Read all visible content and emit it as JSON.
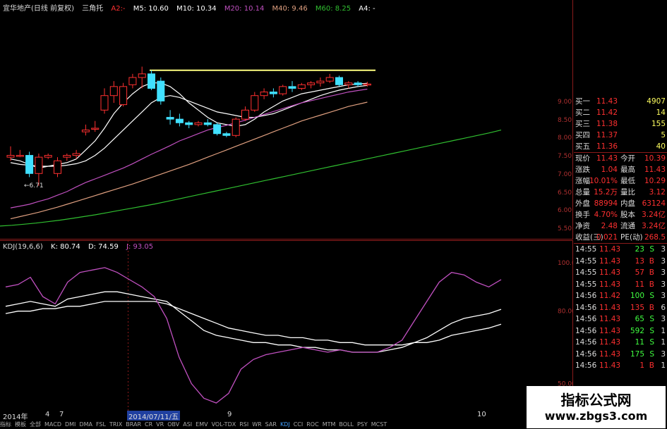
{
  "header": {
    "stock_name": "宜华地产(日线 前复权)",
    "indicator": "三角托",
    "a2": "A2:-",
    "m5": "M5: 10.60",
    "m10": "M10: 10.34",
    "m20": "M20: 10.14",
    "m40": "M40: 9.46",
    "m60": "M60: 8.25",
    "a4": "A4: -",
    "colors": {
      "a2": "#ff3030",
      "m5": "#ffffff",
      "m10": "#ffffff",
      "m20": "#c050c0",
      "m40": "#e0a080",
      "m60": "#30c030",
      "a4": "#ffffff"
    }
  },
  "price_axis": [
    "9.00",
    "8.50",
    "8.00",
    "7.50",
    "7.00",
    "6.50",
    "6.00",
    "5.50"
  ],
  "low_marker": "←6.71",
  "kdj": {
    "title": "KDJ(19,6,6)",
    "k": "K: 80.74",
    "d": "D: 74.59",
    "j": "J: 93.05",
    "k_color": "#ffffff",
    "d_color": "#ffffff",
    "j_color": "#c050c0",
    "axis": [
      "100.00",
      "80.00",
      "50.00"
    ]
  },
  "chart_data": [
    {
      "type": "candlestick",
      "title": "宜华地产(日线 前复权)",
      "y_ticks": [
        9.0,
        8.5,
        8.0,
        7.5,
        7.0,
        6.5,
        6.0,
        5.5
      ],
      "candles": [
        {
          "o": 7.5,
          "h": 7.8,
          "l": 7.4,
          "c": 7.55
        },
        {
          "o": 7.55,
          "h": 7.7,
          "l": 7.5,
          "c": 7.55
        },
        {
          "o": 7.55,
          "h": 7.65,
          "l": 6.95,
          "c": 7.05
        },
        {
          "o": 7.05,
          "h": 7.6,
          "l": 6.71,
          "c": 7.5
        },
        {
          "o": 7.5,
          "h": 7.6,
          "l": 7.45,
          "c": 7.55
        },
        {
          "o": 7.05,
          "h": 7.5,
          "l": 6.95,
          "c": 7.4
        },
        {
          "o": 7.5,
          "h": 7.6,
          "l": 7.4,
          "c": 7.55
        },
        {
          "o": 7.55,
          "h": 7.7,
          "l": 7.45,
          "c": 7.6
        },
        {
          "o": 8.2,
          "h": 8.4,
          "l": 8.1,
          "c": 8.25
        },
        {
          "o": 8.3,
          "h": 8.5,
          "l": 8.2,
          "c": 8.3
        },
        {
          "o": 8.8,
          "h": 9.4,
          "l": 8.7,
          "c": 9.2
        },
        {
          "o": 9.2,
          "h": 9.6,
          "l": 9.0,
          "c": 9.45
        },
        {
          "o": 8.95,
          "h": 9.55,
          "l": 8.9,
          "c": 9.45
        },
        {
          "o": 9.5,
          "h": 9.8,
          "l": 9.4,
          "c": 9.7
        },
        {
          "o": 9.7,
          "h": 10.0,
          "l": 9.4,
          "c": 9.8
        },
        {
          "o": 9.8,
          "h": 9.9,
          "l": 9.35,
          "c": 9.4
        },
        {
          "o": 9.6,
          "h": 9.7,
          "l": 8.95,
          "c": 9.05
        },
        {
          "o": 8.6,
          "h": 8.8,
          "l": 8.4,
          "c": 8.55
        },
        {
          "o": 8.55,
          "h": 8.7,
          "l": 8.35,
          "c": 8.45
        },
        {
          "o": 8.45,
          "h": 8.5,
          "l": 8.3,
          "c": 8.4
        },
        {
          "o": 8.4,
          "h": 8.5,
          "l": 8.35,
          "c": 8.45
        },
        {
          "o": 8.45,
          "h": 8.55,
          "l": 8.35,
          "c": 8.4
        },
        {
          "o": 8.4,
          "h": 8.45,
          "l": 8.1,
          "c": 8.15
        },
        {
          "o": 8.15,
          "h": 8.2,
          "l": 8.05,
          "c": 8.1
        },
        {
          "o": 8.1,
          "h": 8.6,
          "l": 8.05,
          "c": 8.55
        },
        {
          "o": 8.55,
          "h": 8.9,
          "l": 8.5,
          "c": 8.8
        },
        {
          "o": 8.8,
          "h": 9.3,
          "l": 8.75,
          "c": 9.2
        },
        {
          "o": 9.2,
          "h": 9.4,
          "l": 9.1,
          "c": 9.3
        },
        {
          "o": 9.3,
          "h": 9.4,
          "l": 9.15,
          "c": 9.25
        },
        {
          "o": 9.25,
          "h": 9.5,
          "l": 9.2,
          "c": 9.45
        },
        {
          "o": 9.45,
          "h": 9.6,
          "l": 9.3,
          "c": 9.4
        },
        {
          "o": 9.4,
          "h": 9.55,
          "l": 9.35,
          "c": 9.5
        },
        {
          "o": 9.5,
          "h": 9.6,
          "l": 9.4,
          "c": 9.55
        },
        {
          "o": 9.55,
          "h": 9.7,
          "l": 9.45,
          "c": 9.6
        },
        {
          "o": 9.6,
          "h": 9.8,
          "l": 9.55,
          "c": 9.7
        },
        {
          "o": 9.7,
          "h": 9.75,
          "l": 9.45,
          "c": 9.5
        },
        {
          "o": 9.5,
          "h": 9.6,
          "l": 9.4,
          "c": 9.55
        },
        {
          "o": 9.55,
          "h": 9.6,
          "l": 9.45,
          "c": 9.5
        },
        {
          "o": 9.5,
          "h": 9.58,
          "l": 9.45,
          "c": 9.52
        }
      ],
      "resistance_line": 9.9,
      "ma_series": [
        {
          "name": "M5",
          "color": "#ffffff",
          "values": [
            7.45,
            7.4,
            7.3,
            7.2,
            7.25,
            7.3,
            7.35,
            7.45,
            7.7,
            7.95,
            8.3,
            8.7,
            9.0,
            9.25,
            9.45,
            9.55,
            9.55,
            9.45,
            9.25,
            9.0,
            8.8,
            8.6,
            8.45,
            8.4,
            8.35,
            8.4,
            8.55,
            8.75,
            8.9,
            9.05,
            9.15,
            9.25,
            9.3,
            9.35,
            9.4,
            9.45,
            9.5,
            9.52,
            9.54
          ]
        },
        {
          "name": "M10",
          "color": "#ffffff",
          "values": [
            7.35,
            7.3,
            7.28,
            7.25,
            7.25,
            7.25,
            7.28,
            7.32,
            7.4,
            7.55,
            7.75,
            8.0,
            8.25,
            8.5,
            8.75,
            9.0,
            9.15,
            9.2,
            9.15,
            9.05,
            8.95,
            8.85,
            8.75,
            8.7,
            8.65,
            8.6,
            8.6,
            8.65,
            8.7,
            8.8,
            8.9,
            9.0,
            9.1,
            9.2,
            9.28,
            9.35,
            9.4,
            9.45,
            9.48
          ]
        },
        {
          "name": "M20",
          "color": "#c050c0",
          "values": [
            6.1,
            6.15,
            6.2,
            6.28,
            6.35,
            6.45,
            6.55,
            6.68,
            6.8,
            6.9,
            7.0,
            7.1,
            7.2,
            7.32,
            7.45,
            7.58,
            7.7,
            7.82,
            7.95,
            8.05,
            8.15,
            8.25,
            8.32,
            8.38,
            8.45,
            8.52,
            8.6,
            8.68,
            8.76,
            8.84,
            8.92,
            9.0,
            9.06,
            9.12,
            9.18,
            9.24,
            9.3,
            9.34,
            9.38
          ]
        },
        {
          "name": "M40",
          "color": "#e0a080",
          "values": [
            5.8,
            5.86,
            5.92,
            5.98,
            6.05,
            6.12,
            6.2,
            6.28,
            6.36,
            6.44,
            6.52,
            6.6,
            6.68,
            6.76,
            6.85,
            6.94,
            7.03,
            7.12,
            7.21,
            7.3,
            7.4,
            7.5,
            7.6,
            7.7,
            7.8,
            7.9,
            8.0,
            8.1,
            8.2,
            8.3,
            8.4,
            8.5,
            8.58,
            8.66,
            8.74,
            8.82,
            8.9,
            8.96,
            9.02
          ]
        },
        {
          "name": "M60",
          "color": "#30c030",
          "values": [
            5.6,
            5.62,
            5.65,
            5.68,
            5.72,
            5.76,
            5.81,
            5.86,
            5.91,
            5.97,
            6.03,
            6.09,
            6.15,
            6.21,
            6.28,
            6.35,
            6.42,
            6.49,
            6.56,
            6.63,
            6.7,
            6.77,
            6.84,
            6.91,
            6.98,
            7.05,
            7.12,
            7.19,
            7.26,
            7.33,
            7.4,
            7.47,
            7.54,
            7.61,
            7.68,
            7.75,
            7.82,
            7.89,
            7.96,
            8.03,
            8.1,
            8.17,
            8.25
          ]
        }
      ]
    },
    {
      "type": "line",
      "title": "KDJ(19,6,6)",
      "y_ticks": [
        100,
        80,
        50
      ],
      "series": [
        {
          "name": "K",
          "color": "#ffffff",
          "values": [
            82,
            83,
            84,
            83,
            82,
            85,
            86,
            87,
            88,
            88,
            87,
            86,
            85,
            84,
            80,
            76,
            72,
            70,
            69,
            68,
            67,
            67,
            66,
            66,
            65,
            65,
            64,
            64,
            63,
            63,
            63,
            64,
            65,
            67,
            69,
            72,
            75,
            77,
            78,
            79,
            80.74
          ]
        },
        {
          "name": "D",
          "color": "#ffffff",
          "values": [
            79,
            80,
            80,
            81,
            81,
            82,
            82,
            83,
            84,
            84,
            84,
            84,
            84,
            83,
            81,
            79,
            77,
            75,
            73,
            72,
            71,
            70,
            70,
            69,
            69,
            68,
            68,
            67,
            67,
            66,
            66,
            66,
            66,
            67,
            67,
            68,
            70,
            71,
            72,
            73,
            74.59
          ]
        },
        {
          "name": "J",
          "color": "#c050c0",
          "values": [
            90,
            91,
            94,
            86,
            83,
            92,
            96,
            97,
            98,
            96,
            93,
            90,
            86,
            77,
            61,
            50,
            44,
            42,
            46,
            56,
            60,
            62,
            63,
            64,
            65,
            64,
            63,
            64,
            63,
            63,
            63,
            65,
            68,
            76,
            84,
            92,
            96,
            95,
            92,
            90,
            93.05
          ]
        }
      ]
    }
  ],
  "quote_panel": {
    "bids": [
      {
        "label": "买一",
        "price": "11.43",
        "vol": "4907"
      },
      {
        "label": "买二",
        "price": "11.42",
        "vol": "14"
      },
      {
        "label": "买三",
        "price": "11.38",
        "vol": "155"
      },
      {
        "label": "买四",
        "price": "11.37",
        "vol": "5"
      },
      {
        "label": "买五",
        "price": "11.36",
        "vol": "40"
      }
    ],
    "stats": [
      {
        "l1": "现价",
        "v1": "11.43",
        "l2": "今开",
        "v2": "10.39"
      },
      {
        "l1": "涨跌",
        "v1": "1.04",
        "l2": "最高",
        "v2": "11.43"
      },
      {
        "l1": "涨幅",
        "v1": "10.01%",
        "l2": "最低",
        "v2": "10.29"
      },
      {
        "l1": "总量",
        "v1": "15.2万",
        "l2": "量比",
        "v2": "3.12"
      },
      {
        "l1": "外盘",
        "v1": "88994",
        "l2": "内盘",
        "v2": "63124"
      },
      {
        "l1": "换手",
        "v1": "4.70%",
        "l2": "股本",
        "v2": "3.24亿"
      },
      {
        "l1": "净资",
        "v1": "2.48",
        "l2": "流通",
        "v2": "3.24亿"
      },
      {
        "l1": "收益(三)",
        "v1": "0.021",
        "l2": "PE(动)",
        "v2": "268.5"
      }
    ],
    "ticks": [
      {
        "time": "14:55",
        "price": "11.43",
        "vol": "23",
        "side": "S",
        "n": "3"
      },
      {
        "time": "14:55",
        "price": "11.43",
        "vol": "13",
        "side": "B",
        "n": "3"
      },
      {
        "time": "14:55",
        "price": "11.43",
        "vol": "57",
        "side": "B",
        "n": "3"
      },
      {
        "time": "14:55",
        "price": "11.43",
        "vol": "11",
        "side": "B",
        "n": "3"
      },
      {
        "time": "14:56",
        "price": "11.42",
        "vol": "100",
        "side": "S",
        "n": "3"
      },
      {
        "time": "14:56",
        "price": "11.43",
        "vol": "135",
        "side": "B",
        "n": "6"
      },
      {
        "time": "14:56",
        "price": "11.43",
        "vol": "65",
        "side": "S",
        "n": "3"
      },
      {
        "time": "14:56",
        "price": "11.43",
        "vol": "592",
        "side": "S",
        "n": "1"
      },
      {
        "time": "14:56",
        "price": "11.43",
        "vol": "11",
        "side": "S",
        "n": "1"
      },
      {
        "time": "14:56",
        "price": "11.43",
        "vol": "175",
        "side": "S",
        "n": "3"
      },
      {
        "time": "14:56",
        "price": "11.43",
        "vol": "1",
        "side": "B",
        "n": "1"
      }
    ]
  },
  "date_axis": {
    "labels": [
      "2014年",
      "4",
      "7",
      "2014/07/11/五",
      "9",
      "10"
    ]
  },
  "tabs": [
    "指标",
    "模板",
    "全部",
    "MACD",
    "DMI",
    "DMA",
    "FSL",
    "TRIX",
    "BRAR",
    "CR",
    "VR",
    "OBV",
    "ASI",
    "EMV",
    "VOL-TDX",
    "RSI",
    "WR",
    "SAR",
    "KDJ",
    "CCI",
    "ROC",
    "MTM",
    "BOLL",
    "PSY",
    "MCST"
  ],
  "watermark": {
    "line1": "指标公式网",
    "line2": "www.zbgs3.com"
  }
}
